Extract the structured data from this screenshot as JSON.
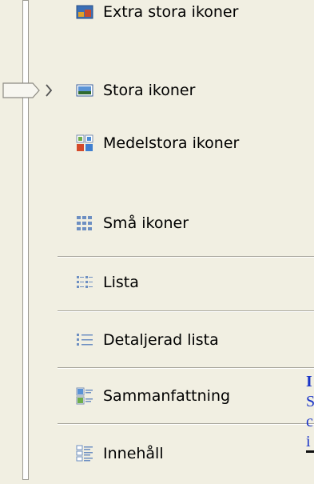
{
  "view_menu": {
    "items": [
      {
        "label": "Extra stora ikoner",
        "icon": "extra-large-icons-icon"
      },
      {
        "label": "Stora ikoner",
        "icon": "large-icons-icon",
        "selected": true
      },
      {
        "label": "Medelstora ikoner",
        "icon": "medium-icons-icon"
      },
      {
        "label": "Små ikoner",
        "icon": "small-icons-icon"
      },
      {
        "label": "Lista",
        "icon": "list-icon"
      },
      {
        "label": "Detaljerad lista",
        "icon": "details-icon"
      },
      {
        "label": "Sammanfattning",
        "icon": "tiles-icon"
      },
      {
        "label": "Innehåll",
        "icon": "content-icon"
      }
    ]
  },
  "side_panel": {
    "line1": "I",
    "line2": "S",
    "line3": "c",
    "line4": "i"
  },
  "colors": {
    "menu_background": "#f1efe2",
    "link_blue": "#1a34c8"
  }
}
